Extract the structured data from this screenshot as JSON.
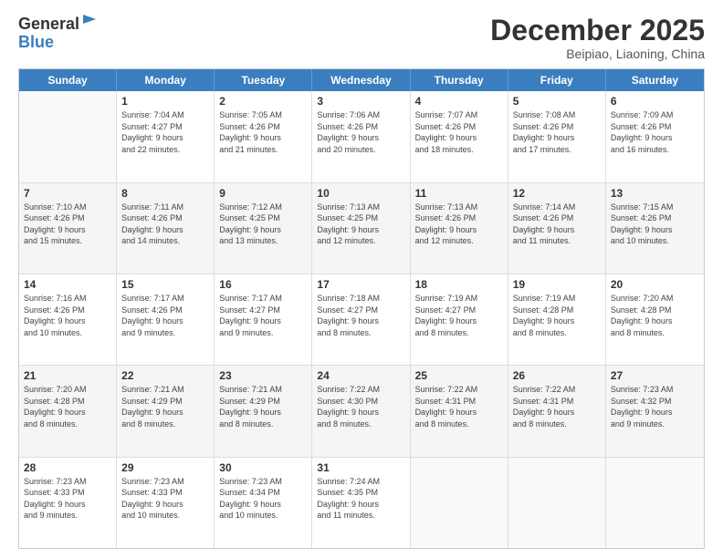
{
  "logo": {
    "general": "General",
    "blue": "Blue"
  },
  "header": {
    "month": "December 2025",
    "location": "Beipiao, Liaoning, China"
  },
  "weekdays": [
    "Sunday",
    "Monday",
    "Tuesday",
    "Wednesday",
    "Thursday",
    "Friday",
    "Saturday"
  ],
  "weeks": [
    [
      {
        "day": "",
        "info": ""
      },
      {
        "day": "1",
        "info": "Sunrise: 7:04 AM\nSunset: 4:27 PM\nDaylight: 9 hours\nand 22 minutes."
      },
      {
        "day": "2",
        "info": "Sunrise: 7:05 AM\nSunset: 4:26 PM\nDaylight: 9 hours\nand 21 minutes."
      },
      {
        "day": "3",
        "info": "Sunrise: 7:06 AM\nSunset: 4:26 PM\nDaylight: 9 hours\nand 20 minutes."
      },
      {
        "day": "4",
        "info": "Sunrise: 7:07 AM\nSunset: 4:26 PM\nDaylight: 9 hours\nand 18 minutes."
      },
      {
        "day": "5",
        "info": "Sunrise: 7:08 AM\nSunset: 4:26 PM\nDaylight: 9 hours\nand 17 minutes."
      },
      {
        "day": "6",
        "info": "Sunrise: 7:09 AM\nSunset: 4:26 PM\nDaylight: 9 hours\nand 16 minutes."
      }
    ],
    [
      {
        "day": "7",
        "info": "Sunrise: 7:10 AM\nSunset: 4:26 PM\nDaylight: 9 hours\nand 15 minutes."
      },
      {
        "day": "8",
        "info": "Sunrise: 7:11 AM\nSunset: 4:26 PM\nDaylight: 9 hours\nand 14 minutes."
      },
      {
        "day": "9",
        "info": "Sunrise: 7:12 AM\nSunset: 4:25 PM\nDaylight: 9 hours\nand 13 minutes."
      },
      {
        "day": "10",
        "info": "Sunrise: 7:13 AM\nSunset: 4:25 PM\nDaylight: 9 hours\nand 12 minutes."
      },
      {
        "day": "11",
        "info": "Sunrise: 7:13 AM\nSunset: 4:26 PM\nDaylight: 9 hours\nand 12 minutes."
      },
      {
        "day": "12",
        "info": "Sunrise: 7:14 AM\nSunset: 4:26 PM\nDaylight: 9 hours\nand 11 minutes."
      },
      {
        "day": "13",
        "info": "Sunrise: 7:15 AM\nSunset: 4:26 PM\nDaylight: 9 hours\nand 10 minutes."
      }
    ],
    [
      {
        "day": "14",
        "info": "Sunrise: 7:16 AM\nSunset: 4:26 PM\nDaylight: 9 hours\nand 10 minutes."
      },
      {
        "day": "15",
        "info": "Sunrise: 7:17 AM\nSunset: 4:26 PM\nDaylight: 9 hours\nand 9 minutes."
      },
      {
        "day": "16",
        "info": "Sunrise: 7:17 AM\nSunset: 4:27 PM\nDaylight: 9 hours\nand 9 minutes."
      },
      {
        "day": "17",
        "info": "Sunrise: 7:18 AM\nSunset: 4:27 PM\nDaylight: 9 hours\nand 8 minutes."
      },
      {
        "day": "18",
        "info": "Sunrise: 7:19 AM\nSunset: 4:27 PM\nDaylight: 9 hours\nand 8 minutes."
      },
      {
        "day": "19",
        "info": "Sunrise: 7:19 AM\nSunset: 4:28 PM\nDaylight: 9 hours\nand 8 minutes."
      },
      {
        "day": "20",
        "info": "Sunrise: 7:20 AM\nSunset: 4:28 PM\nDaylight: 9 hours\nand 8 minutes."
      }
    ],
    [
      {
        "day": "21",
        "info": "Sunrise: 7:20 AM\nSunset: 4:28 PM\nDaylight: 9 hours\nand 8 minutes."
      },
      {
        "day": "22",
        "info": "Sunrise: 7:21 AM\nSunset: 4:29 PM\nDaylight: 9 hours\nand 8 minutes."
      },
      {
        "day": "23",
        "info": "Sunrise: 7:21 AM\nSunset: 4:29 PM\nDaylight: 9 hours\nand 8 minutes."
      },
      {
        "day": "24",
        "info": "Sunrise: 7:22 AM\nSunset: 4:30 PM\nDaylight: 9 hours\nand 8 minutes."
      },
      {
        "day": "25",
        "info": "Sunrise: 7:22 AM\nSunset: 4:31 PM\nDaylight: 9 hours\nand 8 minutes."
      },
      {
        "day": "26",
        "info": "Sunrise: 7:22 AM\nSunset: 4:31 PM\nDaylight: 9 hours\nand 8 minutes."
      },
      {
        "day": "27",
        "info": "Sunrise: 7:23 AM\nSunset: 4:32 PM\nDaylight: 9 hours\nand 9 minutes."
      }
    ],
    [
      {
        "day": "28",
        "info": "Sunrise: 7:23 AM\nSunset: 4:33 PM\nDaylight: 9 hours\nand 9 minutes."
      },
      {
        "day": "29",
        "info": "Sunrise: 7:23 AM\nSunset: 4:33 PM\nDaylight: 9 hours\nand 10 minutes."
      },
      {
        "day": "30",
        "info": "Sunrise: 7:23 AM\nSunset: 4:34 PM\nDaylight: 9 hours\nand 10 minutes."
      },
      {
        "day": "31",
        "info": "Sunrise: 7:24 AM\nSunset: 4:35 PM\nDaylight: 9 hours\nand 11 minutes."
      },
      {
        "day": "",
        "info": ""
      },
      {
        "day": "",
        "info": ""
      },
      {
        "day": "",
        "info": ""
      }
    ]
  ]
}
